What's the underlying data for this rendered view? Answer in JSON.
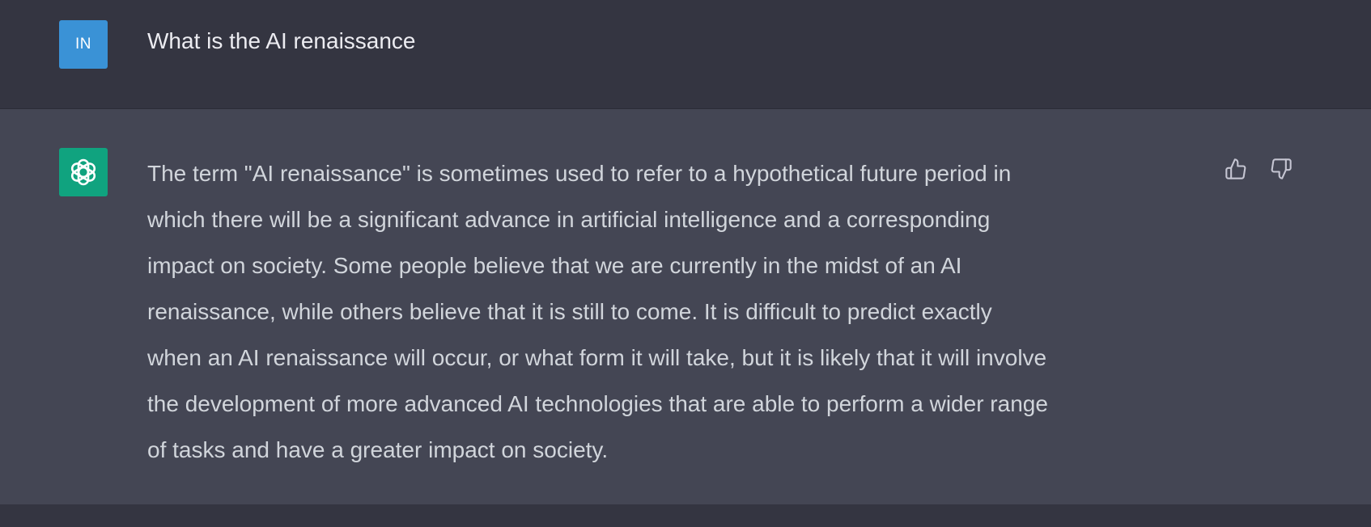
{
  "user_message": {
    "avatar_initials": "IN",
    "text": "What is the AI renaissance"
  },
  "assistant_message": {
    "avatar_icon": "openai-logo-icon",
    "lines": [
      "The term \"AI renaissance\" is sometimes used to refer to a hypothetical future period in",
      "which there will be a significant advance in artificial intelligence and a corresponding",
      "impact on society. Some people believe that we are currently in the midst of an AI",
      "renaissance, while others believe that it is still to come. It is difficult to predict exactly",
      "when an AI renaissance will occur, or what form it will take, but it is likely that it will involve",
      "the development of more advanced AI technologies that are able to perform a wider range",
      "of tasks and have a greater impact on society."
    ],
    "feedback_icons": [
      "thumbs-up-icon",
      "thumbs-down-icon"
    ]
  },
  "colors": {
    "background": "#343541",
    "assistant_background": "#444654",
    "user_avatar": "#3a92d6",
    "assistant_avatar": "#10a37f",
    "user_text": "#ececf1",
    "assistant_text": "#d1d5db"
  }
}
